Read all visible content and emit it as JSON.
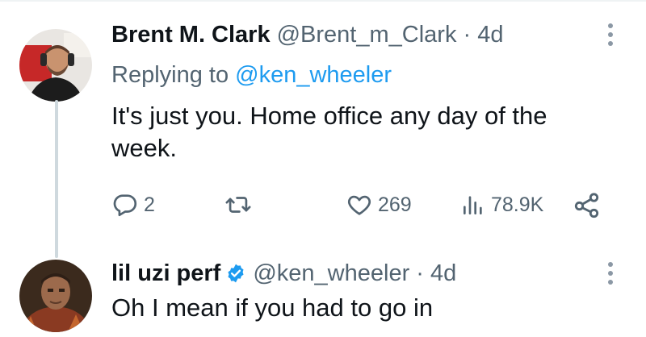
{
  "tweets": [
    {
      "author_name": "Brent M. Clark",
      "handle": "@Brent_m_Clark",
      "separator": "·",
      "time": "4d",
      "replying_prefix": "Replying to",
      "replying_handle": "@ken_wheeler",
      "text_line1": "It's just you.  Home office any day of the",
      "text_line2": "week.",
      "actions": {
        "reply_icon": "reply-icon",
        "reply_count": "2",
        "retweet_icon": "retweet-icon",
        "like_icon": "heart-icon",
        "like_count": "269",
        "views_icon": "analytics-icon",
        "views_count": "78.9K",
        "share_icon": "share-icon"
      }
    },
    {
      "author_name": "lil uzi perf",
      "verified": true,
      "verified_icon": "verified-badge-icon",
      "handle": "@ken_wheeler",
      "separator": "·",
      "time": "4d",
      "text_line1": "Oh I mean if you had to go in"
    }
  ],
  "colors": {
    "text": "#0f1419",
    "secondary": "#536471",
    "link": "#1d9bf0",
    "thread_line": "#cfd9de"
  }
}
